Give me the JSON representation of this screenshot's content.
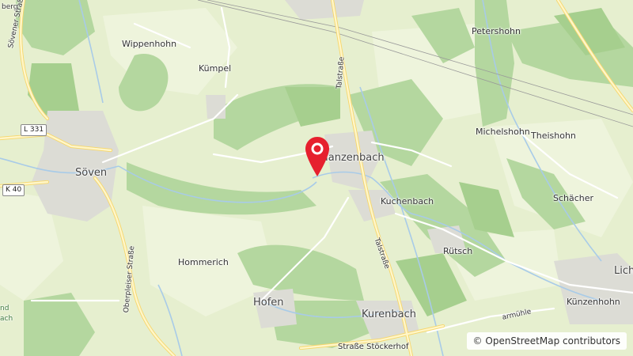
{
  "map": {
    "places": {
      "soven": "Söven",
      "wippenhohn": "Wippenhohn",
      "kumpel": "Kümpel",
      "hanzenbach": "Hanzenbach",
      "kuchenbach": "Kuchenbach",
      "petershohn": "Petershohn",
      "michelshohn": "Michelshohn",
      "theishohn": "Theishohn",
      "schacher": "Schächer",
      "rutsch": "Rütsch",
      "hommerich": "Hommerich",
      "hofen": "Hofen",
      "kurenbach": "Kurenbach",
      "kunzenhohn": "Künzenhohn",
      "lich": "Lich",
      "berg": "berg",
      "and": "nd",
      "ach": "ach"
    },
    "roads": {
      "l331": "L 331",
      "k40": "K 40",
      "sovener_strasse": "Sövener Straße",
      "oberpleiser_strasse": "Oberpleiser Straße",
      "talstrasse_north": "Talstraße",
      "talstrasse_south": "Talstraße",
      "stockerhof": "Straße Stöckerhof",
      "armuhle": "armühle"
    },
    "marker_label": "location-marker",
    "attribution": {
      "symbol": "©",
      "text": "OpenStreetMap contributors"
    },
    "colors": {
      "land": "#e6efcf",
      "forest": "#b4d79f",
      "forest_dark": "#a6cf8e",
      "settlement": "#dcdcd5",
      "farmland": "#eef4dc",
      "road": "#ffffff",
      "road_major": "#fbe8a0",
      "stream": "#a8cbe8",
      "marker": "#e6202e"
    }
  }
}
